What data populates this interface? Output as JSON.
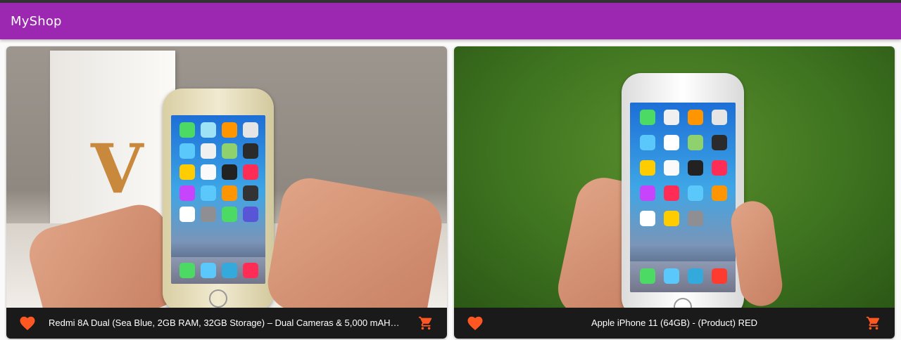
{
  "app": {
    "title": "MyShop"
  },
  "colors": {
    "appbar": "#9c27b0",
    "accent": "#ff5722",
    "footer": "#1a1a1a"
  },
  "products": [
    {
      "title": "Redmi 8A Dual (Sea Blue, 2GB RAM, 32GB Storage) – Dual Cameras & 5,000 mAH…",
      "favorite_icon": "heart-icon",
      "cart_icon": "shopping-cart-icon",
      "image": "phone-in-hands-photo"
    },
    {
      "title": "Apple iPhone 11 (64GB) - (Product) RED",
      "favorite_icon": "heart-icon",
      "cart_icon": "shopping-cart-icon",
      "image": "phone-in-hand-on-grass-photo"
    }
  ]
}
